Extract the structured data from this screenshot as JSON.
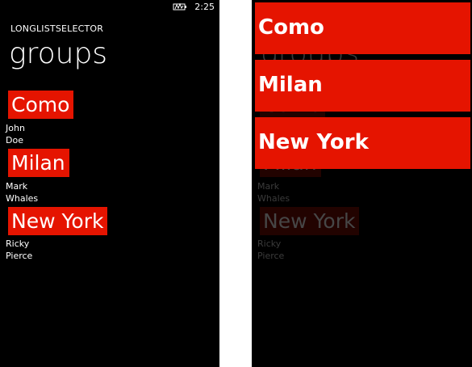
{
  "left_screen": {
    "status_bar": {
      "time": "2:25",
      "icon": "battery-signal-icon"
    },
    "app_title": "LONGLISTSELECTOR",
    "page_title": "groups",
    "groups": [
      {
        "header": "Como",
        "items": [
          "John",
          "Doe"
        ]
      },
      {
        "header": "Milan",
        "items": [
          "Mark",
          "Whales"
        ]
      },
      {
        "header": "New York",
        "items": [
          "Ricky",
          "Pierce"
        ]
      }
    ]
  },
  "right_screen": {
    "jump_list": [
      "Como",
      "Milan",
      "New York"
    ],
    "background": {
      "page_title": "groups",
      "groups": [
        {
          "header": "Como",
          "items": [
            "",
            ""
          ]
        },
        {
          "header": "Milan",
          "items": [
            "Mark",
            "Whales"
          ]
        },
        {
          "header": "New York",
          "items": [
            "Ricky",
            "Pierce"
          ]
        }
      ]
    }
  },
  "colors": {
    "accent": "#e51400",
    "background": "#000000",
    "text": "#ffffff"
  }
}
